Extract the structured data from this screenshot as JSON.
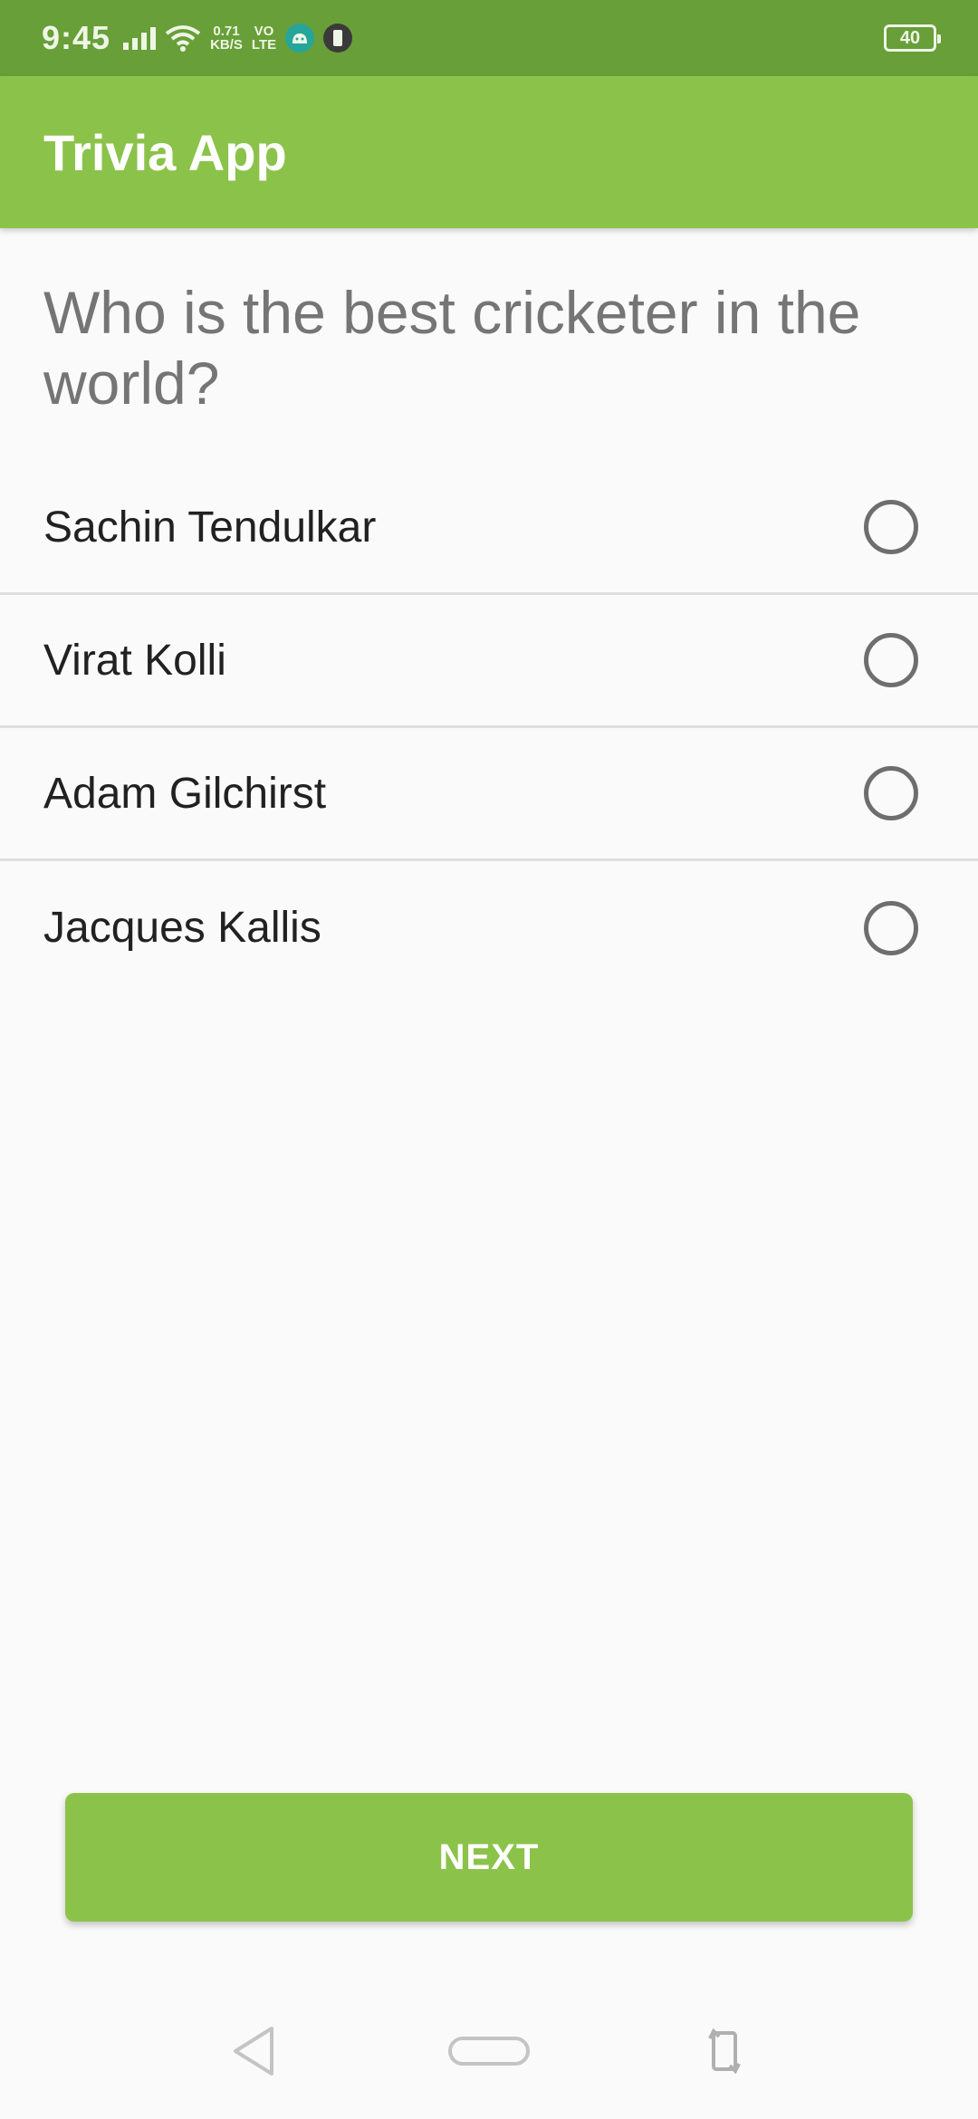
{
  "status_bar": {
    "time": "9:45",
    "net_speed_value": "0.71",
    "net_speed_unit": "KB/S",
    "volte_top": "VO",
    "volte_bottom": "LTE",
    "battery_level": "40"
  },
  "app_bar": {
    "title": "Trivia App",
    "color": "#8bc34a"
  },
  "question": {
    "text": "Who is the best cricketer in the world?"
  },
  "options": [
    {
      "label": "Sachin Tendulkar",
      "selected": false
    },
    {
      "label": "Virat Kolli",
      "selected": false
    },
    {
      "label": "Adam Gilchirst",
      "selected": false
    },
    {
      "label": "Jacques Kallis",
      "selected": false
    }
  ],
  "next_button": {
    "label": "NEXT"
  },
  "nav_bar": {
    "icons": [
      "back-icon",
      "home-icon",
      "rotate-icon"
    ]
  }
}
